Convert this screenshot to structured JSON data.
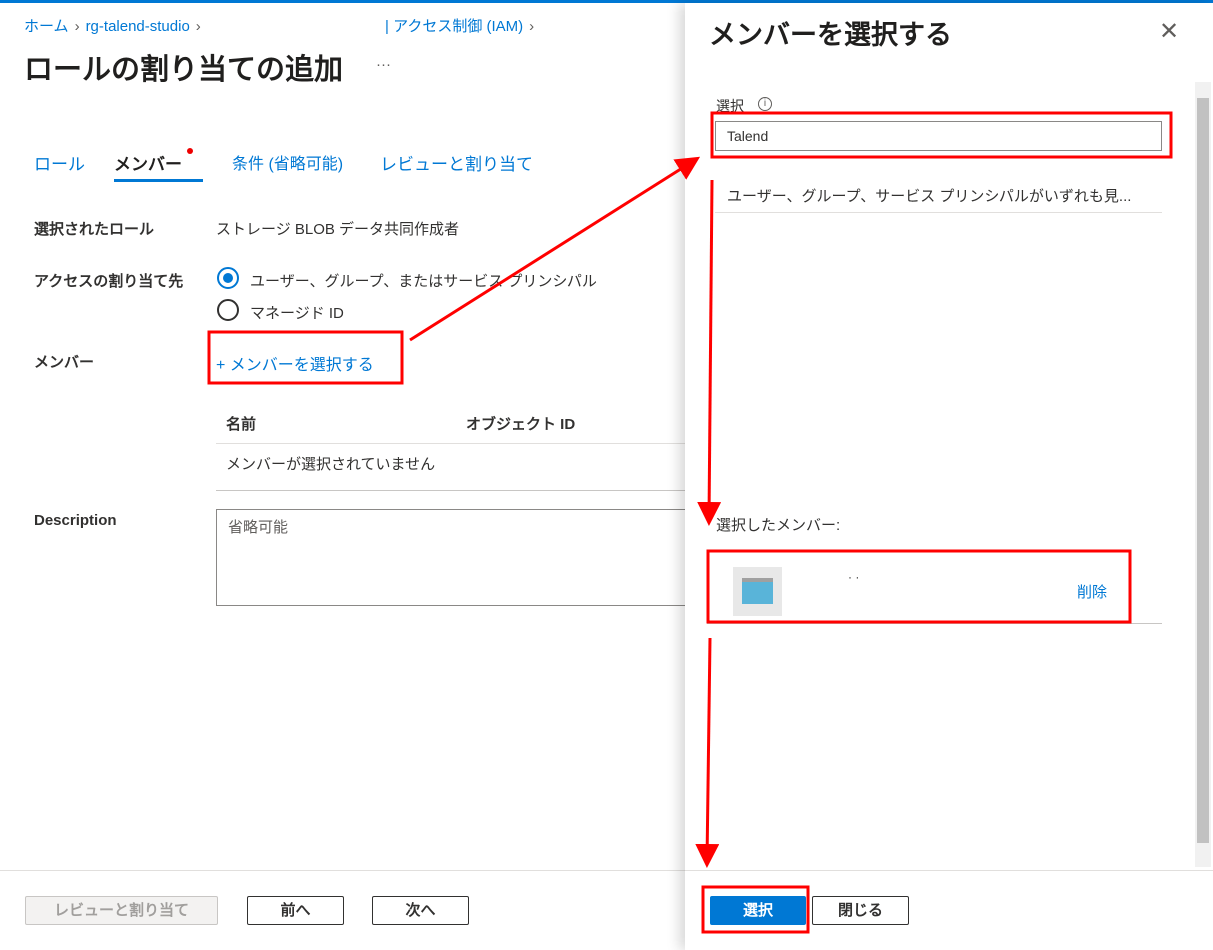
{
  "breadcrumb": {
    "home": "ホーム",
    "rg": "rg-talend-studio",
    "iam": "| アクセス制御 (IAM)"
  },
  "page_title": "ロールの割り当ての追加",
  "more": "···",
  "tabs": [
    {
      "label": "ロール"
    },
    {
      "label": "メンバー"
    },
    {
      "label": "条件 (省略可能)"
    },
    {
      "label": "レビューと割り当て"
    }
  ],
  "form": {
    "role_label": "選択されたロール",
    "role_value": "ストレージ BLOB データ共同作成者",
    "access_label": "アクセスの割り当て先",
    "option1": "ユーザー、グループ、またはサービス プリンシパル",
    "option2": "マネージド ID",
    "members_label": "メンバー",
    "select_members": "+ メンバーを選択する",
    "col_name": "名前",
    "col_object_id": "オブジェクト ID",
    "empty": "メンバーが選択されていません",
    "description_label": "Description",
    "description_placeholder": "省略可能"
  },
  "footer": {
    "review": "レビューと割り当て",
    "prev": "前へ",
    "next": "次へ"
  },
  "panel": {
    "title": "メンバーを選択する",
    "select_label": "選択",
    "search_value": "Talend",
    "result_text": "ユーザー、グループ、サービス プリンシパルがいずれも見...",
    "selected_label": "選択したメンバー:",
    "member_name": "· ·",
    "remove": "削除",
    "select_button": "選択",
    "close_button": "閉じる"
  },
  "colors": {
    "accent": "#0078d4",
    "annotation": "#ff0000"
  }
}
